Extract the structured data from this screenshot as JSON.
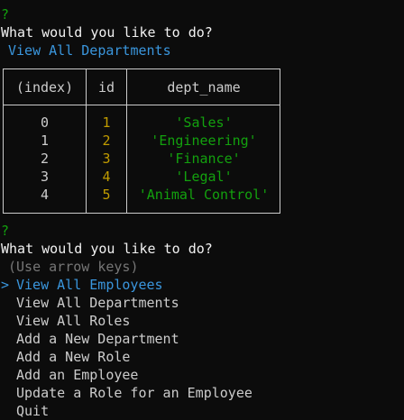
{
  "prompt1": {
    "marker": "?",
    "question": "What would you like to do?",
    "answer": "View All Departments"
  },
  "table": {
    "headers": [
      "(index)",
      "id",
      "dept_name"
    ],
    "rows": [
      [
        "0",
        "1",
        "'Sales'"
      ],
      [
        "1",
        "2",
        "'Engineering'"
      ],
      [
        "2",
        "3",
        "'Finance'"
      ],
      [
        "3",
        "4",
        "'Legal'"
      ],
      [
        "4",
        "5",
        "'Animal Control'"
      ]
    ]
  },
  "prompt2": {
    "marker": "?",
    "question": "What would you like to do?",
    "hint": "(Use arrow keys)",
    "cursor": ">",
    "selected_index": 0,
    "options": [
      "View All Employees",
      "View All Departments",
      "View All Roles",
      "Add a New Department",
      "Add a New Role",
      "Add an Employee",
      "Update a Role for an Employee",
      "Quit"
    ]
  },
  "colors": {
    "background": "#0c0c0c",
    "text": "#cccccc",
    "question_marker": "#13a10e",
    "answer": "#3a96dd",
    "id_column": "#c19c00",
    "name_column": "#13a10e",
    "hint": "#767676"
  }
}
